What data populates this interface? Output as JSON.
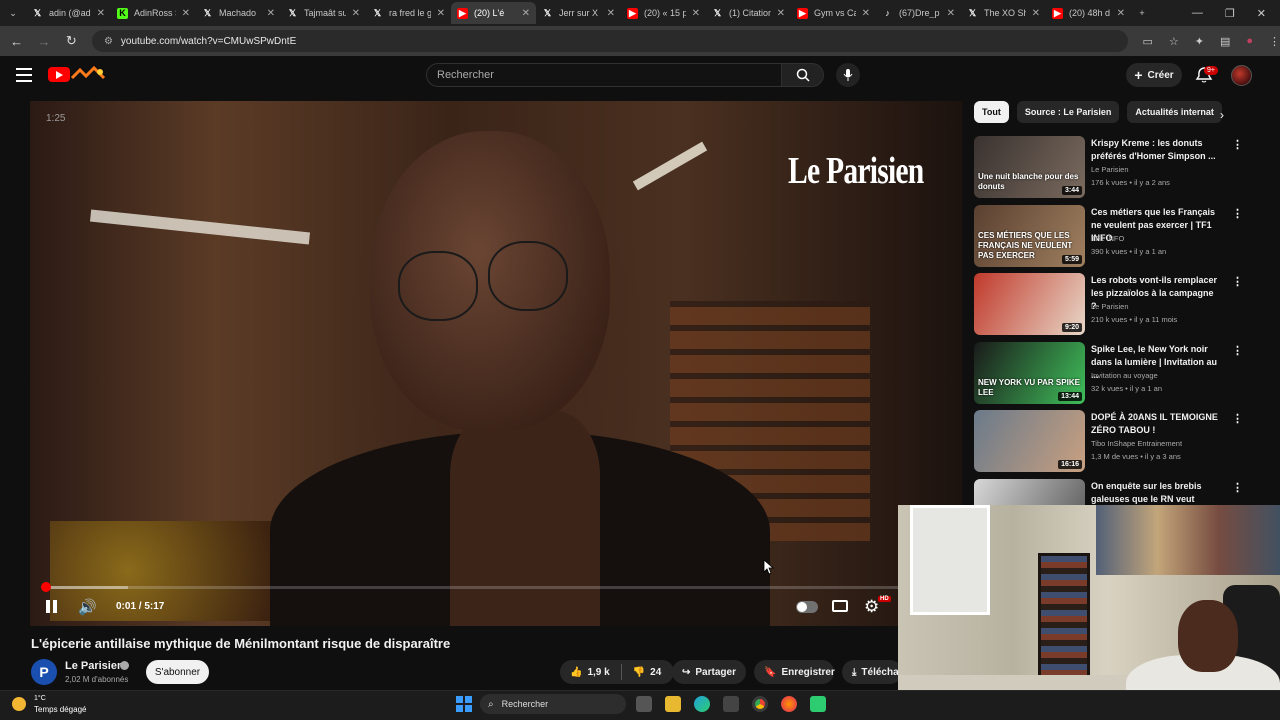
{
  "browser": {
    "tabs": [
      {
        "title": "adin (@ad",
        "icon": "x-icon",
        "active": false
      },
      {
        "title": "AdinRoss S",
        "icon": "kick-icon",
        "active": false
      },
      {
        "title": "Machado",
        "icon": "x-icon",
        "active": false
      },
      {
        "title": "Tajmaât su",
        "icon": "x-icon",
        "active": false
      },
      {
        "title": "ra fred le g",
        "icon": "x-icon",
        "active": false
      },
      {
        "title": "(20) L'é",
        "icon": "youtube-icon",
        "active": true
      },
      {
        "title": "Jerr sur X :",
        "icon": "x-icon",
        "active": false
      },
      {
        "title": "(20) « 15 p",
        "icon": "youtube-icon",
        "active": false
      },
      {
        "title": "(1) Citation",
        "icon": "x-icon",
        "active": false
      },
      {
        "title": "Gym vs Ca",
        "icon": "youtube-icon",
        "active": false
      },
      {
        "title": "(67)Dre_p",
        "icon": "tiktok-icon",
        "active": false
      },
      {
        "title": "The XO Sh",
        "icon": "x-icon",
        "active": false
      },
      {
        "title": "(20) 48h d",
        "icon": "youtube-icon",
        "active": false
      }
    ],
    "new_tab": "+",
    "url": "youtube.com/watch?v=CMUwSPwDntE"
  },
  "header": {
    "search_placeholder": "Rechercher",
    "create_label": "Créer",
    "notif_count": "9+"
  },
  "player": {
    "overlay_time": "1:25",
    "watermark": "Le Parisien",
    "time": "0:01 / 5:17",
    "progress_fraction": 0.003,
    "buffered_fraction": 0.1
  },
  "video": {
    "title": "L'épicerie antillaise mythique de Ménilmontant risque de disparaître",
    "channel": "Le Parisien",
    "channel_initial": "P",
    "subscribers": "2,02 M d'abonnés",
    "subscribe_label": "S'abonner",
    "likes": "1,9 k",
    "dislikes": "24",
    "share_label": "Partager",
    "save_label": "Enregistrer",
    "download_label": "Téléchar"
  },
  "chips": [
    "Tout",
    "Source : Le Parisien",
    "Actualités internat"
  ],
  "recommendations": [
    {
      "title": "Krispy Kreme : les donuts préférés d'Homer Simpson ...",
      "channel": "Le Parisien",
      "meta": "176 k vues • il y a 2 ans",
      "duration": "3:44",
      "thumb_text": "Une nuit blanche pour des donuts",
      "thumb_colors": [
        "#3a3330",
        "#7a6a5e"
      ]
    },
    {
      "title": "Ces métiers que les Français ne veulent pas exercer | TF1 INFO",
      "channel": "TF1 INFO",
      "meta": "390 k vues • il y a 1 an",
      "duration": "5:59",
      "thumb_text": "CES MÉTIERS QUE LES FRANÇAIS NE VEULENT PAS EXERCER",
      "thumb_colors": [
        "#5a4030",
        "#a08060"
      ]
    },
    {
      "title": "Les robots vont-ils remplacer les pizzaïolos à la campagne ?",
      "channel": "Le Parisien",
      "meta": "210 k vues • il y a 11 mois",
      "duration": "9:20",
      "thumb_text": "",
      "thumb_colors": [
        "#c0392b",
        "#e8d8c8"
      ]
    },
    {
      "title": "Spike Lee, le New York noir dans la lumière | Invitation au ...",
      "channel": "Invitation au voyage",
      "meta": "32 k vues • il y a 1 an",
      "duration": "13:44",
      "thumb_text": "NEW YORK VU PAR SPIKE LEE",
      "thumb_colors": [
        "#1a1a1a",
        "#3fbf5a"
      ]
    },
    {
      "title": "DOPÉ À 20ANS IL TEMOIGNE ZÉRO TABOU !",
      "channel": "Tibo InShape Entrainement",
      "meta": "1,3 M de vues • il y a 3 ans",
      "duration": "16:16",
      "thumb_text": "",
      "thumb_colors": [
        "#6a7a8a",
        "#c9a080"
      ]
    },
    {
      "title": "On enquête sur les brebis galeuses que le RN veut cache...",
      "channel": "",
      "meta": "",
      "duration": "",
      "thumb_text": "",
      "thumb_colors": [
        "#d8d8d8",
        "#555555"
      ]
    }
  ],
  "taskbar": {
    "temp": "1°C",
    "weather": "Temps dégagé",
    "search": "Rechercher"
  },
  "colors": {
    "accent": "#ff0000",
    "background": "#0f0f0f"
  }
}
